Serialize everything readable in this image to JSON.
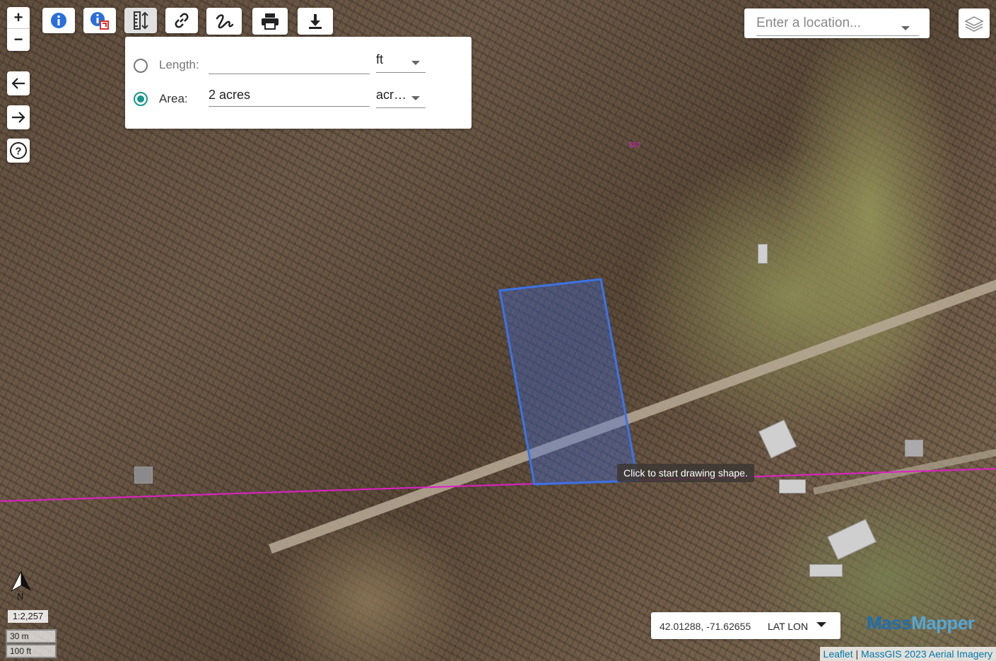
{
  "map": {
    "parcel_label": "520",
    "tooltip": "Click to start drawing shape."
  },
  "zoom": {
    "in": "+",
    "out": "−"
  },
  "toolbar": {
    "icons": [
      "info-icon",
      "identify-parcel-icon",
      "measure-icon",
      "link-icon",
      "draw-icon",
      "print-icon",
      "download-icon"
    ]
  },
  "nav": {
    "back": "back-arrow-icon",
    "forward": "forward-arrow-icon",
    "help": "help-icon"
  },
  "measure": {
    "length_label": "Length:",
    "length_value": "",
    "length_unit": "ft",
    "area_label": "Area:",
    "area_value": "2 acres",
    "area_unit": "acr…",
    "selected": "area"
  },
  "search": {
    "placeholder": "Enter a location..."
  },
  "scale": {
    "ratio": "1:2,257",
    "metric": "30 m",
    "imperial": "100 ft",
    "north": "N"
  },
  "coords": {
    "value": "42.01288, -71.62655",
    "mode": "LAT LON"
  },
  "brand": {
    "part1": "Mass",
    "part2": "Mapper"
  },
  "attribution": {
    "leaflet": "Leaflet",
    "sep": " | ",
    "imagery": "MassGIS 2023 Aerial Imagery"
  },
  "colors": {
    "accent": "#159688",
    "boundary": "#e020c8",
    "shape": "#3b73e8"
  }
}
